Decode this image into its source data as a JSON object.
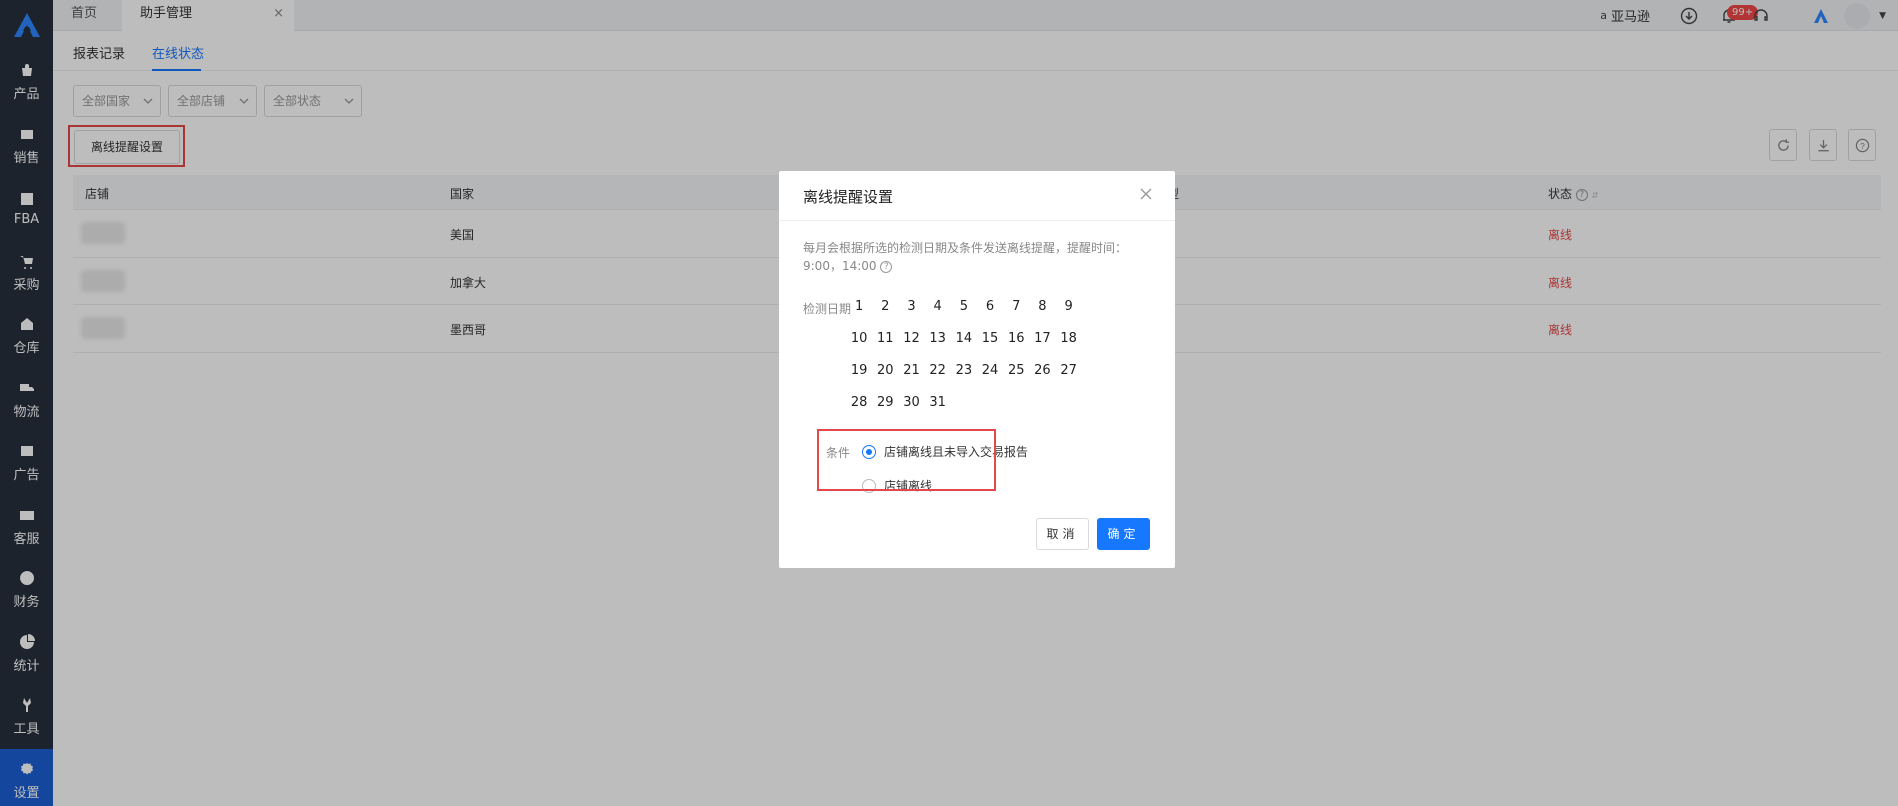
{
  "sidebar": {
    "items": [
      {
        "label": "产品",
        "icon": "bag-icon"
      },
      {
        "label": "销售",
        "icon": "sell-icon"
      },
      {
        "label": "FBA",
        "icon": "amazon-icon"
      },
      {
        "label": "采购",
        "icon": "cart-icon"
      },
      {
        "label": "仓库",
        "icon": "warehouse-icon"
      },
      {
        "label": "物流",
        "icon": "truck-icon"
      },
      {
        "label": "广告",
        "icon": "ad-icon"
      },
      {
        "label": "客服",
        "icon": "mail-icon"
      },
      {
        "label": "财务",
        "icon": "yen-icon"
      },
      {
        "label": "统计",
        "icon": "pie-icon"
      },
      {
        "label": "工具",
        "icon": "wrench-icon"
      },
      {
        "label": "设置",
        "icon": "gear-icon"
      }
    ],
    "active_index": 11
  },
  "topbar": {
    "tabs": [
      {
        "label": "首页"
      },
      {
        "label": "助手管理",
        "close": "×"
      }
    ],
    "amazon_label": "亚马逊",
    "notif_badge": "99+"
  },
  "subtabs": [
    {
      "label": "报表记录"
    },
    {
      "label": "在线状态"
    }
  ],
  "filters": [
    {
      "label": "全部国家"
    },
    {
      "label": "全部店铺"
    },
    {
      "label": "全部状态"
    }
  ],
  "offline_button": "离线提醒设置",
  "table": {
    "headers": {
      "shop": "店铺",
      "country": "国家",
      "type": "类型",
      "status": "状态"
    },
    "rows": [
      {
        "country": "美国",
        "status": "离线"
      },
      {
        "country": "加拿大",
        "status": "离线"
      },
      {
        "country": "墨西哥",
        "status": "离线"
      }
    ]
  },
  "modal": {
    "title": "离线提醒设置",
    "desc": "每月会根据所选的检测日期及条件发送离线提醒，提醒时间：9:00，14:00",
    "date_label": "检测日期",
    "dates": [
      "1",
      "2",
      "3",
      "4",
      "5",
      "6",
      "7",
      "8",
      "9",
      "10",
      "11",
      "12",
      "13",
      "14",
      "15",
      "16",
      "17",
      "18",
      "19",
      "20",
      "21",
      "22",
      "23",
      "24",
      "25",
      "26",
      "27",
      "28",
      "29",
      "30",
      "31"
    ],
    "condition_label": "条件",
    "options": [
      {
        "label": "店铺离线且未导入交易报告",
        "checked": true
      },
      {
        "label": "店铺离线",
        "checked": false
      }
    ],
    "cancel": "取消",
    "ok": "确定"
  },
  "colors": {
    "primary": "#1677ff",
    "sidebar": "#27303d",
    "danger": "#e54848"
  }
}
